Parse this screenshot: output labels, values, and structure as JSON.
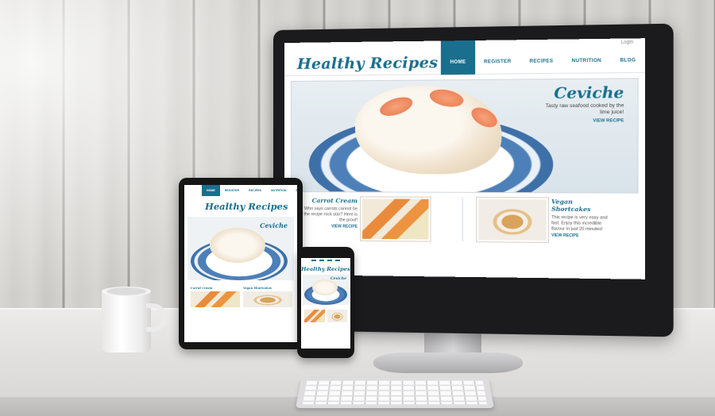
{
  "site": {
    "login": "Login",
    "logo": "Healthy Recipes",
    "nav": [
      "HOME",
      "REGISTER",
      "RECIPES",
      "NUTRITION",
      "BLOG"
    ],
    "hero": {
      "title": "Ceviche",
      "subtitle": "Tasty raw seafood cooked by the lime juice!",
      "link": "VIEW RECIPE"
    },
    "cards": [
      {
        "title": "Carrot Cream",
        "desc": "Who says carrots cannot be the recipe rock star? Here is the proof!",
        "link": "VIEW RECIPE"
      },
      {
        "title": "Vegan Shortcakes",
        "desc": "This recipe is very easy and fast. Enjoy this incredible flavour in just 20 minutes!",
        "link": "VIEW RECIPE"
      }
    ]
  },
  "colors": {
    "brand": "#1a6f8e",
    "plate_blue": "#4d80b8",
    "device_black": "#161617"
  },
  "icons": [
    "slider-dot-icon"
  ]
}
